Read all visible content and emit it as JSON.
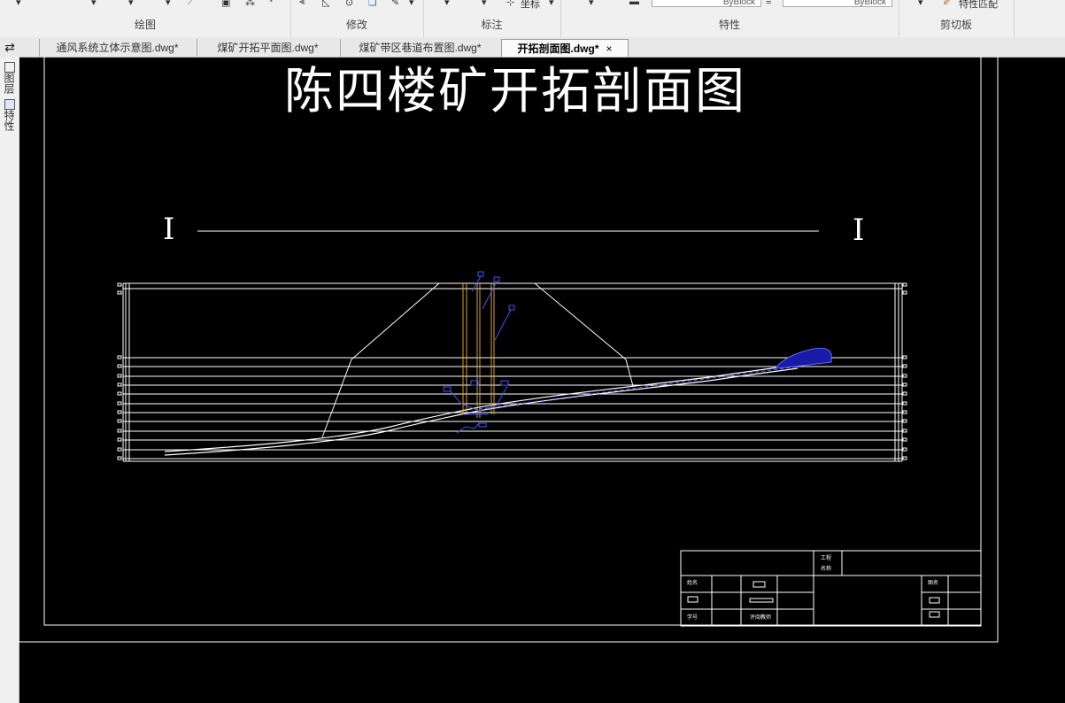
{
  "ribbon": {
    "groups": [
      {
        "label": "绘图"
      },
      {
        "label": "修改"
      },
      {
        "label": "标注"
      },
      {
        "label": "特性"
      },
      {
        "label": "剪切板"
      }
    ],
    "coord_tool": "坐标",
    "props": [
      "ByBlock",
      "ByBlock"
    ],
    "match_prop": "特性匹配"
  },
  "tabs": [
    {
      "label": "通风系统立体示意图.dwg*"
    },
    {
      "label": "煤矿开拓平面图.dwg*"
    },
    {
      "label": "煤矿带区巷道布置图.dwg*"
    },
    {
      "label": "开拓剖面图.dwg*",
      "close": "×"
    }
  ],
  "side_panel": {
    "layers_label": "图层",
    "props_label": "特性"
  },
  "drawing": {
    "title": "陈四楼矿开拓剖面图",
    "section_left": "I",
    "section_right": "I",
    "title_block": {
      "project_name_l1": "工程",
      "project_name_l2": "名称",
      "name": "姓名",
      "student_no": "学号",
      "reviewer": "评阅教师",
      "drawing_name": "图名"
    }
  }
}
